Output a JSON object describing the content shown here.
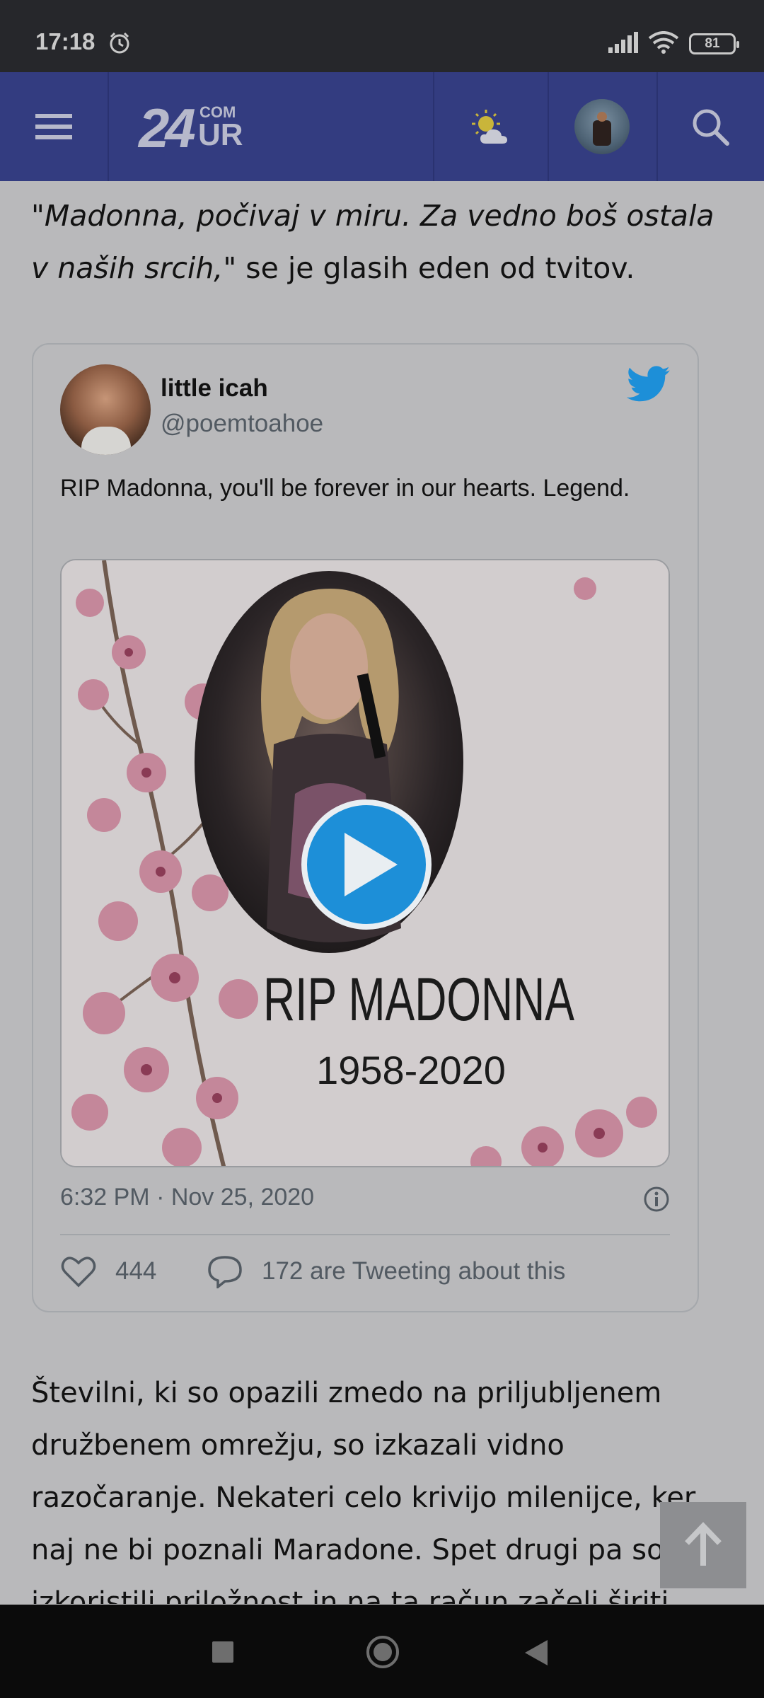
{
  "status_bar": {
    "time": "17:18",
    "battery": "81"
  },
  "header": {
    "logo_main": "24",
    "logo_top": "COM",
    "logo_bottom": "UR"
  },
  "article": {
    "quote_italic": "\"Madonna, počivaj v miru. Za vedno boš ostala v naših srcih,\"",
    "quote_rest": " se je glasih eden od tvitov.",
    "body": "Številni, ki so opazili zmedo na priljubljenem družbenem omrežju, so izkazali vidno razočaranje. Nekateri celo krivijo milenijce, ker naj ne bi poznali Maradone. Spet drugi pa so izkoristili priložnost in na ta račun začeli širiti"
  },
  "tweet": {
    "name": "little icah",
    "handle": "@poemtoahoe",
    "text": "RIP Madonna, you'll be forever in our hearts. Legend.",
    "media_title": "RIP MADONNA",
    "media_years": "1958-2020",
    "timestamp": "6:32 PM · Nov 25, 2020",
    "likes": "444",
    "replies": "172 are Tweeting about this"
  },
  "colors": {
    "header_bg": "#333c80",
    "twitter_blue": "#1d8fd8",
    "page_bg": "#b9b9bb"
  }
}
